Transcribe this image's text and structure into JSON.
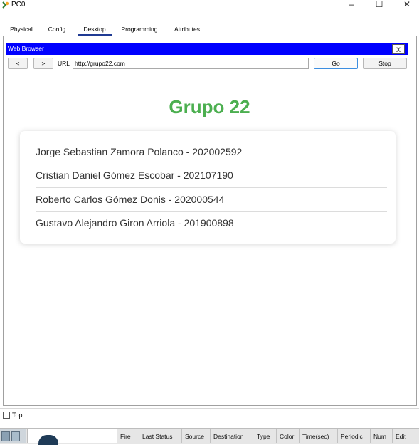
{
  "window": {
    "title": "PC0"
  },
  "tabs": [
    {
      "label": "Physical"
    },
    {
      "label": "Config"
    },
    {
      "label": "Desktop",
      "active": true
    },
    {
      "label": "Programming"
    },
    {
      "label": "Attributes"
    }
  ],
  "browser": {
    "title": "Web Browser",
    "close_label": "X",
    "back_label": "<",
    "forward_label": ">",
    "url_label": "URL",
    "url_value": "http://grupo22.com",
    "go_label": "Go",
    "stop_label": "Stop"
  },
  "page": {
    "heading": "Grupo 22",
    "members": [
      "Jorge Sebastian Zamora Polanco - 202002592",
      "Cristian Daniel Gómez Escobar - 202107190",
      "Roberto Carlos Gómez Donis - 202000544",
      "Gustavo Alejandro Giron Arriola - 201900898"
    ]
  },
  "bottom": {
    "top_label": "Top",
    "columns": [
      "Fire",
      "Last Status",
      "Source",
      "Destination",
      "Type",
      "Color",
      "Time(sec)",
      "Periodic",
      "Num",
      "Edit"
    ]
  },
  "colors": {
    "browser_bar": "#0000ff",
    "heading": "#4caf50",
    "active_tab": "#1f3a93"
  }
}
